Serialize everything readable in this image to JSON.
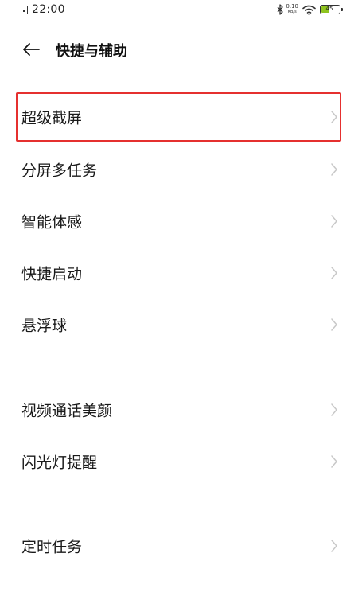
{
  "status_bar": {
    "time": "22:00",
    "net_speed": "0.10",
    "net_unit": "KB/s",
    "battery_level": "45",
    "battery_fraction": 0.45,
    "battery_color": "#8fc41f",
    "icons": [
      "sim-icon",
      "bluetooth-icon",
      "wifi-icon",
      "battery-icon"
    ]
  },
  "header": {
    "back_icon": "arrow-left-icon",
    "title": "快捷与辅助"
  },
  "highlight_color": "#e5302f",
  "items": [
    {
      "label": "超级截屏",
      "highlighted": true
    },
    {
      "label": "分屏多任务"
    },
    {
      "label": "智能体感"
    },
    {
      "label": "快捷启动"
    },
    {
      "label": "悬浮球"
    },
    {
      "label": "视频通话美颜"
    },
    {
      "label": "闪光灯提醒"
    },
    {
      "label": "定时任务"
    }
  ]
}
